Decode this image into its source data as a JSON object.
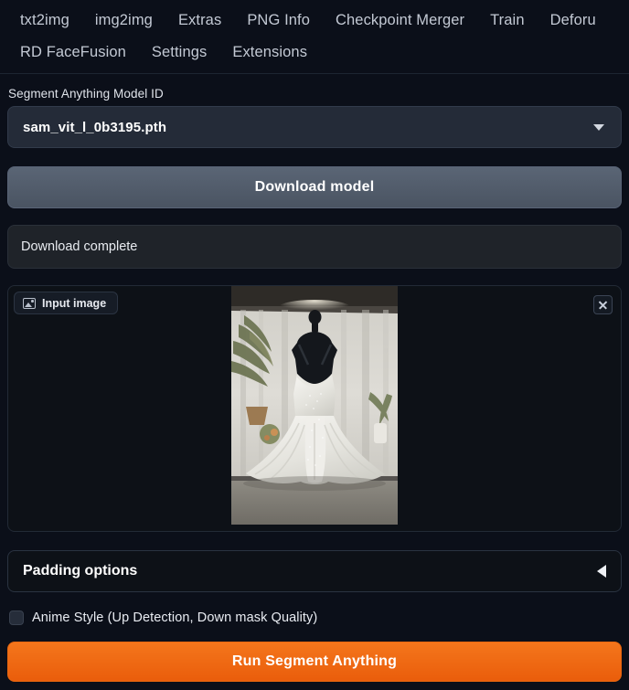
{
  "tabs": {
    "row1": [
      {
        "label": "txt2img"
      },
      {
        "label": "img2img"
      },
      {
        "label": "Extras"
      },
      {
        "label": "PNG Info"
      },
      {
        "label": "Checkpoint Merger"
      },
      {
        "label": "Train"
      },
      {
        "label": "Deforu"
      }
    ],
    "row2": [
      {
        "label": "RD FaceFusion"
      },
      {
        "label": "Settings"
      },
      {
        "label": "Extensions"
      }
    ]
  },
  "model": {
    "label": "Segment Anything Model ID",
    "selected": "sam_vit_l_0b3195.pth",
    "caret_icon": "chevron-down-icon"
  },
  "download": {
    "button_label": "Download model",
    "status": "Download complete"
  },
  "image_panel": {
    "tab_label": "Input image",
    "tab_icon": "picture-icon",
    "close_icon": "close-icon"
  },
  "padding": {
    "title": "Padding options",
    "caret_icon": "chevron-left-icon"
  },
  "anime": {
    "label": "Anime Style (Up Detection, Down mask Quality)",
    "checked": false
  },
  "run": {
    "label": "Run Segment Anything"
  },
  "colors": {
    "page_bg": "#0b0f19",
    "panel_bg": "#0d1117",
    "field_bg": "#242b38",
    "status_bg": "#1f2329",
    "accent_orange": "#ea5d0b",
    "secondary_btn": "#4a5462",
    "text": "#d7dbe3"
  }
}
